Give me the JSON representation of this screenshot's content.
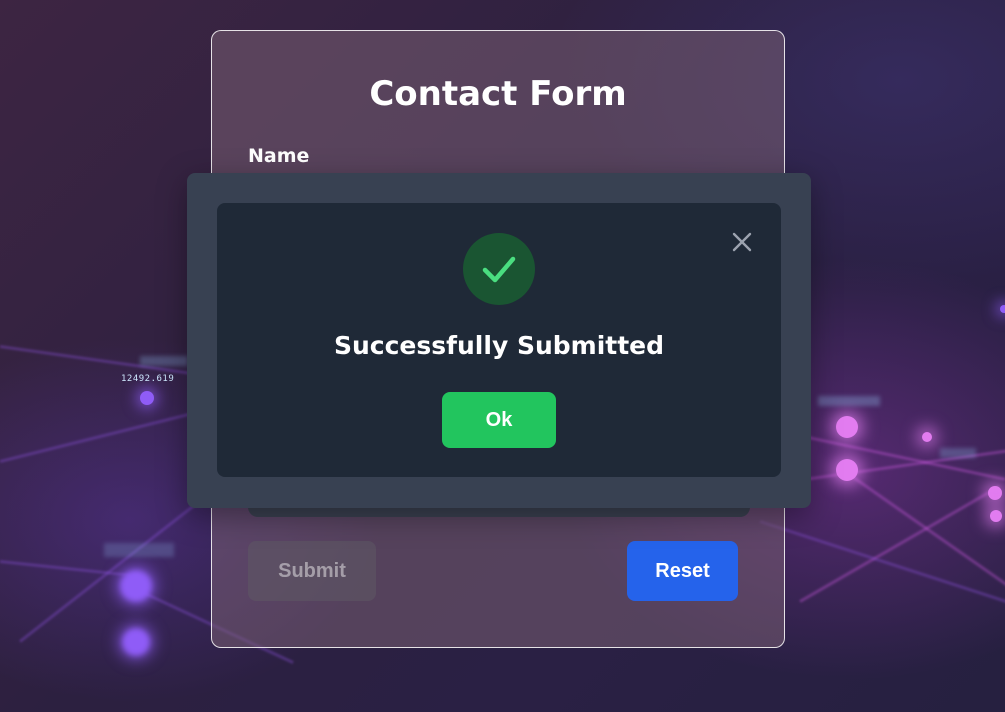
{
  "background": {
    "node_labels": [
      "12492.619"
    ]
  },
  "form": {
    "title": "Contact Form",
    "name_label": "Name",
    "submit_label": "Submit",
    "reset_label": "Reset"
  },
  "modal": {
    "message": "Successfully Submitted",
    "ok_label": "Ok",
    "icons": {
      "status": "check-icon",
      "close": "close-icon"
    }
  },
  "colors": {
    "success": "#22c55e",
    "reset": "#2563eb",
    "modal_bg": "#1f2937",
    "modal_frame": "#384152"
  }
}
